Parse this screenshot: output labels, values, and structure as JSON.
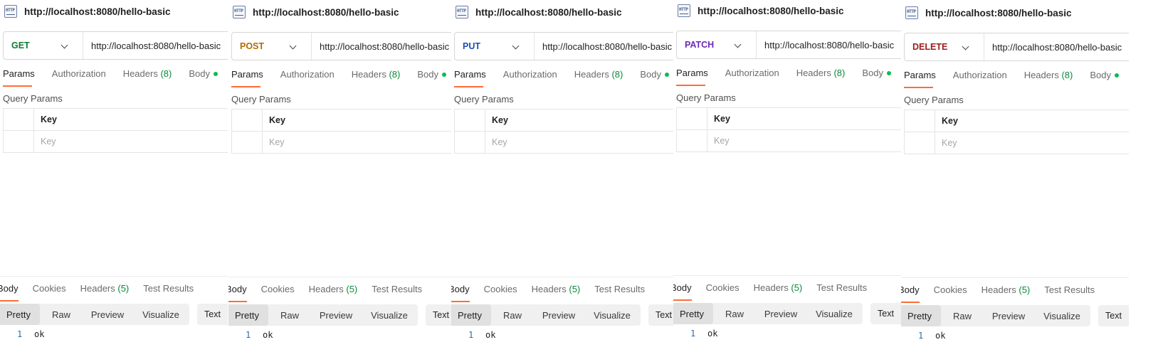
{
  "title": "http://localhost:8080/hello-basic",
  "icon": "http-icon",
  "icon_text": "HTTP",
  "url": "http://localhost:8080/hello-basic",
  "request_tabs": {
    "params": "Params",
    "authorization": "Authorization",
    "headers": "Headers",
    "headers_count": "(8)",
    "body": "Body"
  },
  "query_params": {
    "label": "Query Params",
    "key_header": "Key",
    "key_placeholder": "Key"
  },
  "response_tabs": {
    "body": "Body",
    "cookies": "Cookies",
    "headers": "Headers",
    "headers_count": "(5)",
    "test_results": "Test Results"
  },
  "view_modes": [
    "Pretty",
    "Raw",
    "Preview",
    "Visualize"
  ],
  "format": "Text",
  "response_body": {
    "line_number": "1",
    "text": "ok"
  },
  "panels": [
    {
      "method": "GET",
      "method_color": "#0a7d33"
    },
    {
      "method": "POST",
      "method_color": "#b36b00"
    },
    {
      "method": "PUT",
      "method_color": "#1d4fb0"
    },
    {
      "method": "PATCH",
      "method_color": "#6b2bb3"
    },
    {
      "method": "DELETE",
      "method_color": "#9b1c1c"
    }
  ],
  "colors": {
    "accent": "#ff6c37",
    "count_green": "#0a8a3a",
    "dot_green": "#0cbb52"
  }
}
